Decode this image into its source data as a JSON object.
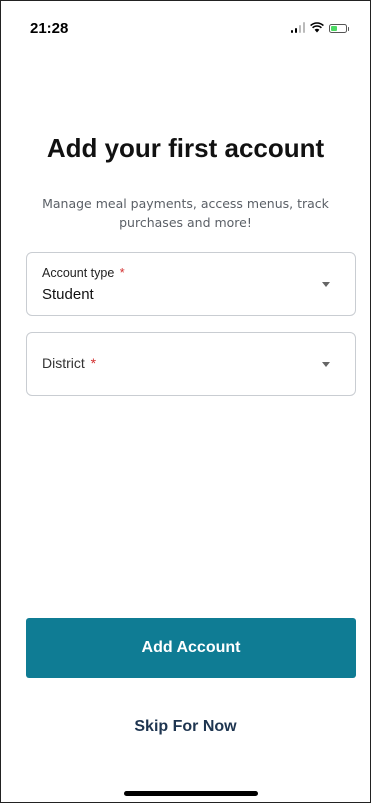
{
  "status_bar": {
    "time": "21:28",
    "icons": [
      "signal-icon",
      "wifi-icon",
      "battery-charging-icon"
    ]
  },
  "header": {
    "title": "Add your first account",
    "subtitle": "Manage meal payments, access menus, track purchases and more!"
  },
  "form": {
    "account_type": {
      "label": "Account type",
      "required_mark": "*",
      "value": "Student"
    },
    "district": {
      "label": "District",
      "required_mark": "*",
      "value": ""
    }
  },
  "actions": {
    "add_account_label": "Add Account",
    "skip_label": "Skip For Now"
  },
  "colors": {
    "primary": "#0f7c94",
    "link": "#1e3550",
    "required": "#d32f2f"
  }
}
